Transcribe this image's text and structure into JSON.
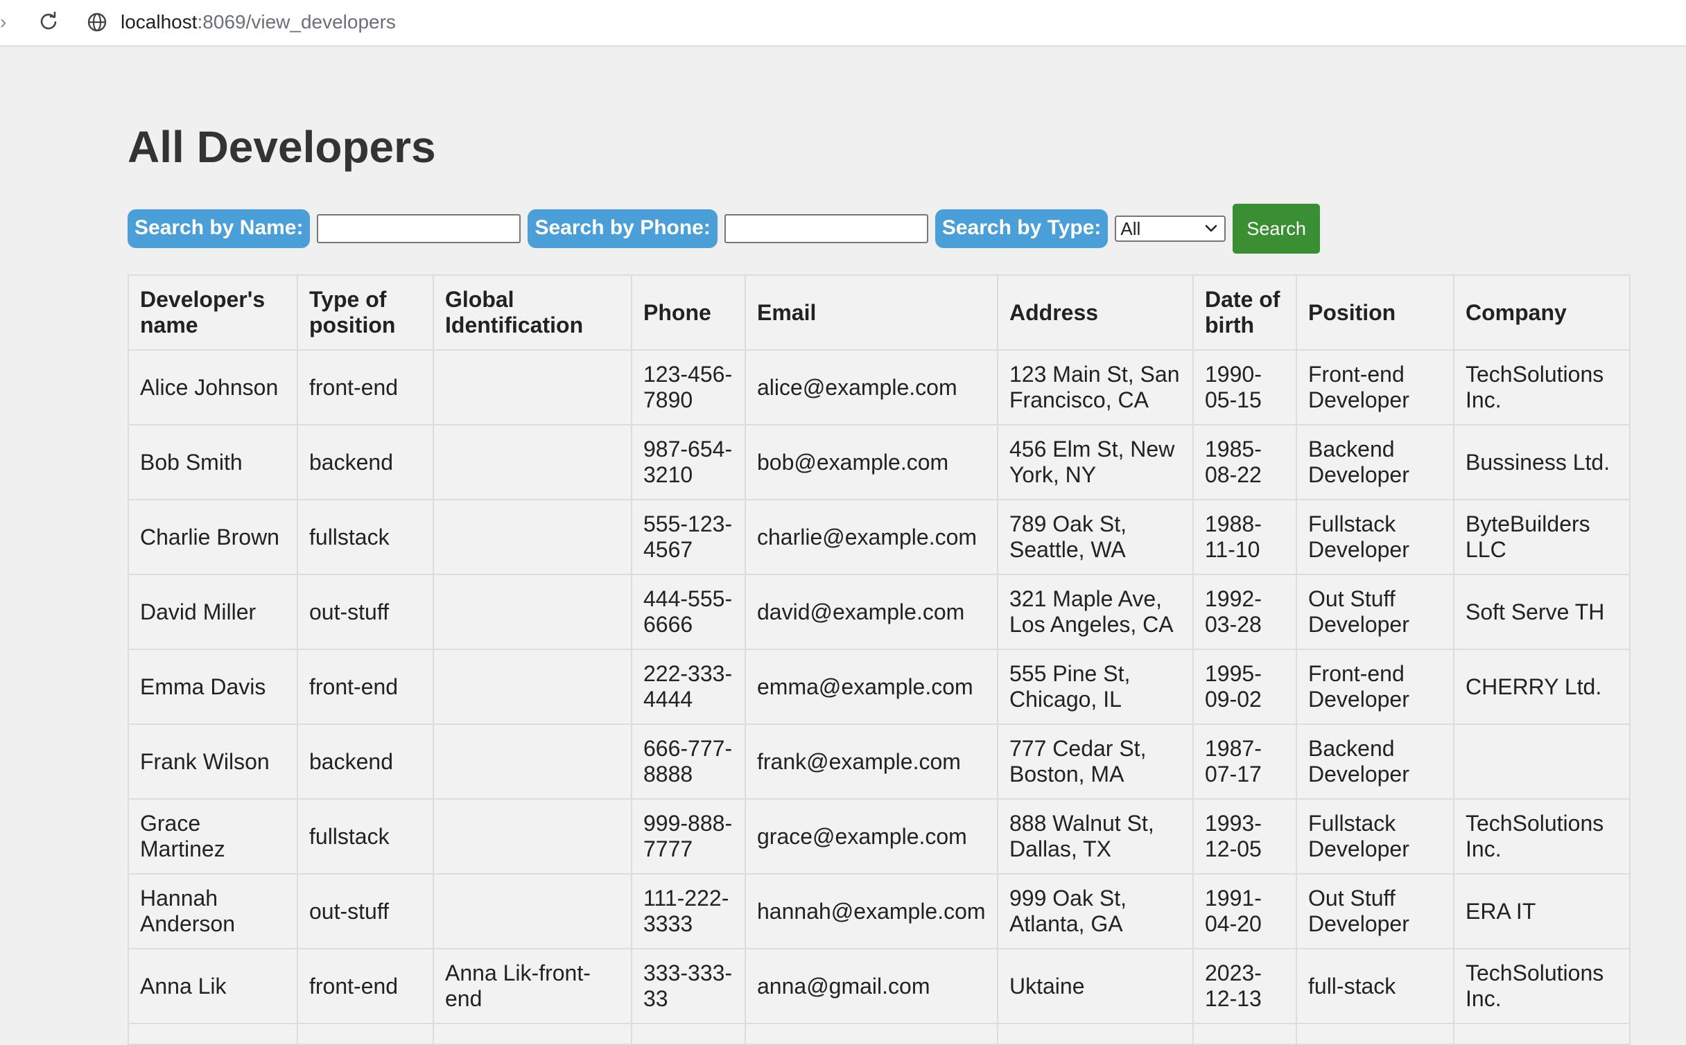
{
  "browser": {
    "url_host": "localhost",
    "url_rest": ":8069/view_developers"
  },
  "page": {
    "title": "All Developers"
  },
  "search": {
    "name_label": "Search by Name:",
    "name_value": "",
    "phone_label": "Search by Phone:",
    "phone_value": "",
    "type_label": "Search by Type:",
    "type_selected": "All",
    "button_label": "Search"
  },
  "colors": {
    "label_bg": "#4a9fd8",
    "button_bg": "#3a8f32",
    "page_bg": "#f0f0f0"
  },
  "table": {
    "headers": [
      "Developer's name",
      "Type of position",
      "Global Identification",
      "Phone",
      "Email",
      "Address",
      "Date of birth",
      "Position",
      "Company"
    ],
    "rows": [
      [
        "Alice Johnson",
        "front-end",
        "",
        "123-456-7890",
        "alice@example.com",
        "123 Main St, San Francisco, CA",
        "1990-05-15",
        "Front-end Developer",
        "TechSolutions Inc."
      ],
      [
        "Bob Smith",
        "backend",
        "",
        "987-654-3210",
        "bob@example.com",
        "456 Elm St, New York, NY",
        "1985-08-22",
        "Backend Developer",
        "Bussiness Ltd."
      ],
      [
        "Charlie Brown",
        "fullstack",
        "",
        "555-123-4567",
        "charlie@example.com",
        "789 Oak St, Seattle, WA",
        "1988-11-10",
        "Fullstack Developer",
        "ByteBuilders LLC"
      ],
      [
        "David Miller",
        "out-stuff",
        "",
        "444-555-6666",
        "david@example.com",
        "321 Maple Ave, Los Angeles, CA",
        "1992-03-28",
        "Out Stuff Developer",
        "Soft Serve TH"
      ],
      [
        "Emma Davis",
        "front-end",
        "",
        "222-333-4444",
        "emma@example.com",
        "555 Pine St, Chicago, IL",
        "1995-09-02",
        "Front-end Developer",
        "CHERRY Ltd."
      ],
      [
        "Frank Wilson",
        "backend",
        "",
        "666-777-8888",
        "frank@example.com",
        "777 Cedar St, Boston, MA",
        "1987-07-17",
        "Backend Developer",
        ""
      ],
      [
        "Grace Martinez",
        "fullstack",
        "",
        "999-888-7777",
        "grace@example.com",
        "888 Walnut St, Dallas, TX",
        "1993-12-05",
        "Fullstack Developer",
        "TechSolutions Inc."
      ],
      [
        "Hannah Anderson",
        "out-stuff",
        "",
        "111-222-3333",
        "hannah@example.com",
        "999 Oak St, Atlanta, GA",
        "1991-04-20",
        "Out Stuff Developer",
        "ERA IT"
      ],
      [
        "Anna Lik",
        "front-end",
        "Anna Lik-front-end",
        "333-333-33",
        "anna@gmail.com",
        "Uktaine",
        "2023-12-13",
        "full-stack",
        "TechSolutions Inc."
      ]
    ]
  }
}
